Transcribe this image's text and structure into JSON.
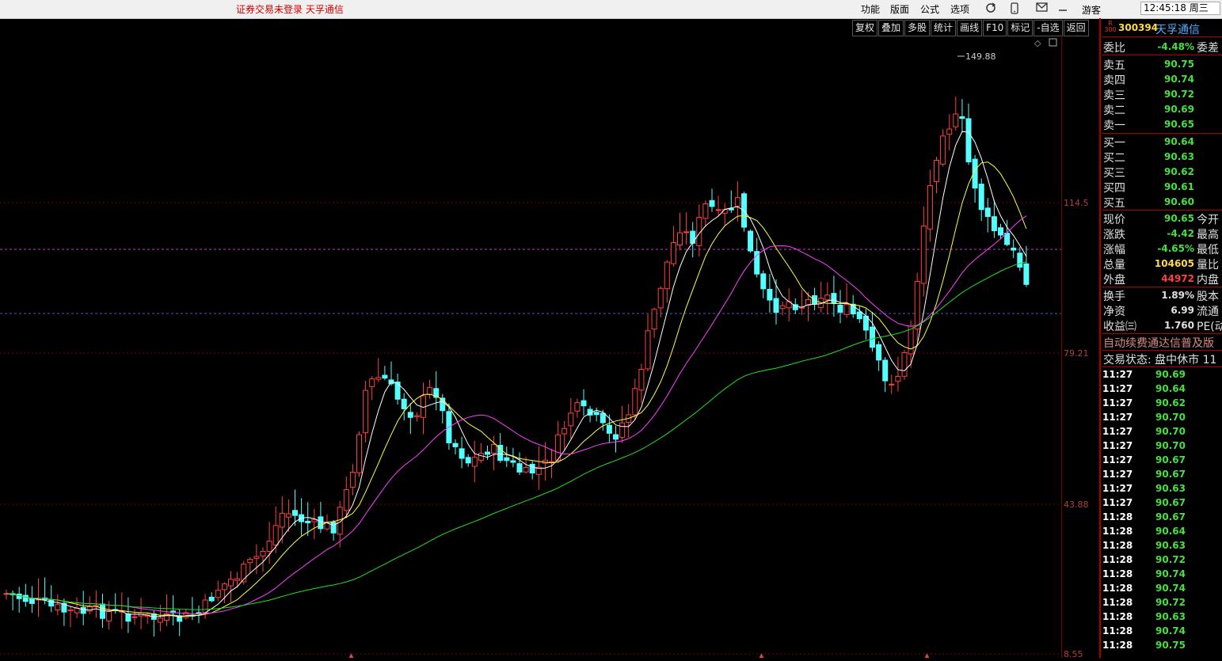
{
  "topbar": {
    "notice": "证券交易未登录  天孚通信",
    "menus": [
      "功能",
      "版面",
      "公式",
      "选项"
    ],
    "guest": "游客",
    "clock": "12:45:18 周三"
  },
  "toolbar": [
    "复权",
    "叠加",
    "多股",
    "统计",
    "画线",
    "F10",
    "标记",
    "-自选",
    "返回"
  ],
  "chart": {
    "peak_label": "149.88",
    "y_labels": [
      "114.5",
      "79.21",
      "43.88",
      "8.55"
    ],
    "ma_colors": {
      "ma5": "#ffffff",
      "ma10": "#ffff40",
      "ma20": "#ff40ff",
      "ma60": "#20e020"
    },
    "up_color": "#ff4040",
    "down_color": "#54ffff"
  },
  "panel": {
    "badge_top": "R",
    "badge_bottom": "300",
    "code": "300394",
    "name": "天孚通信",
    "weibi": {
      "label": "委比",
      "value": "-4.48%",
      "ext": "委差"
    },
    "asks": [
      {
        "label": "卖五",
        "price": "90.75"
      },
      {
        "label": "卖四",
        "price": "90.74"
      },
      {
        "label": "卖三",
        "price": "90.72"
      },
      {
        "label": "卖二",
        "price": "90.69"
      },
      {
        "label": "卖一",
        "price": "90.65"
      }
    ],
    "bids": [
      {
        "label": "买一",
        "price": "90.64"
      },
      {
        "label": "买二",
        "price": "90.63"
      },
      {
        "label": "买三",
        "price": "90.62"
      },
      {
        "label": "买四",
        "price": "90.61"
      },
      {
        "label": "买五",
        "price": "90.60"
      }
    ],
    "stats1": [
      {
        "label": "现价",
        "value": "90.65",
        "ext": "今开",
        "color": "#46e040"
      },
      {
        "label": "涨跌",
        "value": "-4.42",
        "ext": "最高",
        "color": "#46e040"
      },
      {
        "label": "涨幅",
        "value": "-4.65%",
        "ext": "最低",
        "color": "#46e040"
      },
      {
        "label": "总量",
        "value": "104605",
        "ext": "量比",
        "color": "#ffdc40"
      },
      {
        "label": "外盘",
        "value": "44972",
        "ext": "内盘",
        "color": "#ff4040"
      }
    ],
    "stats2": [
      {
        "label": "换手",
        "value": "1.89%",
        "ext": "股本",
        "color": "#e0e0e0"
      },
      {
        "label": "净资",
        "value": "6.99",
        "ext": "流通",
        "color": "#e0e0e0"
      },
      {
        "label": "收益㈢",
        "value": "1.760",
        "ext": "PE(动",
        "color": "#e0e0e0"
      }
    ],
    "ticker": "自动续费通达信普及版",
    "trade_status": "交易状态: 盘中休市 11",
    "ticks": [
      {
        "time": "11:27",
        "price": "90.69"
      },
      {
        "time": "11:27",
        "price": "90.64"
      },
      {
        "time": "11:27",
        "price": "90.62"
      },
      {
        "time": "11:27",
        "price": "90.70"
      },
      {
        "time": "11:27",
        "price": "90.70"
      },
      {
        "time": "11:27",
        "price": "90.70"
      },
      {
        "time": "11:27",
        "price": "90.67"
      },
      {
        "time": "11:27",
        "price": "90.67"
      },
      {
        "time": "11:27",
        "price": "90.63"
      },
      {
        "time": "11:27",
        "price": "90.67"
      },
      {
        "time": "11:28",
        "price": "90.67"
      },
      {
        "time": "11:28",
        "price": "90.64"
      },
      {
        "time": "11:28",
        "price": "90.63"
      },
      {
        "time": "11:28",
        "price": "90.72"
      },
      {
        "time": "11:28",
        "price": "90.74"
      },
      {
        "time": "11:28",
        "price": "90.74"
      },
      {
        "time": "11:28",
        "price": "90.72"
      },
      {
        "time": "11:28",
        "price": "90.63"
      },
      {
        "time": "11:28",
        "price": "90.74"
      },
      {
        "time": "11:28",
        "price": "90.75"
      }
    ]
  }
}
